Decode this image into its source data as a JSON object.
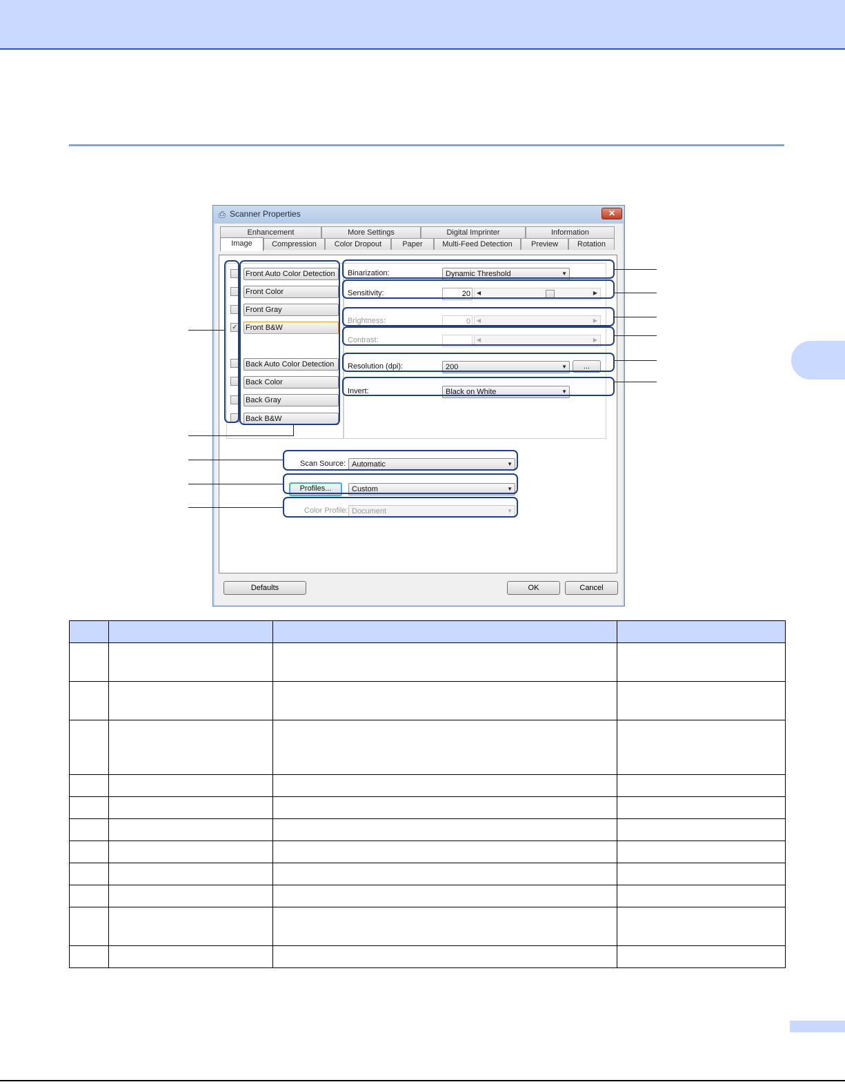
{
  "dialog": {
    "title": "Scanner Properties",
    "close_glyph": "✕",
    "tabs_back": [
      "Enhancement",
      "More Settings",
      "Digital Imprinter",
      "Information"
    ],
    "tabs_front": [
      "Image",
      "Compression",
      "Color Dropout",
      "Paper",
      "Multi-Feed Detection",
      "Preview",
      "Rotation"
    ],
    "active_tab": "Image"
  },
  "image_types": [
    {
      "label": "Front Auto Color Detection",
      "checked": false
    },
    {
      "label": "Front Color",
      "checked": false
    },
    {
      "label": "Front Gray",
      "checked": false
    },
    {
      "label": "Front B&W",
      "checked": true
    },
    {
      "label": "Back Auto Color Detection",
      "checked": false
    },
    {
      "label": "Back Color",
      "checked": false
    },
    {
      "label": "Back Gray",
      "checked": false
    },
    {
      "label": "Back B&W",
      "checked": false
    }
  ],
  "check_glyph": "✓",
  "settings": {
    "binarization": {
      "label": "Binarization:",
      "value": "Dynamic Threshold"
    },
    "sensitivity": {
      "label": "Sensitivity:",
      "value": "20",
      "level": 0.6
    },
    "brightness": {
      "label": "Brightness:",
      "value": "0",
      "enabled": false
    },
    "contrast": {
      "label": "Contrast:",
      "value": "",
      "enabled": false
    },
    "resolution": {
      "label": "Resolution (dpi):",
      "value": "200",
      "more_button": "..."
    },
    "invert": {
      "label": "Invert:",
      "value": "Black on White"
    }
  },
  "scan_source": {
    "label": "Scan Source:",
    "value": "Automatic"
  },
  "profiles": {
    "button": "Profiles...",
    "value": "Custom"
  },
  "color_profile": {
    "label": "Color Profile:",
    "value": "Document",
    "enabled": false
  },
  "buttons": {
    "defaults": "Defaults",
    "ok": "OK",
    "cancel": "Cancel"
  },
  "icons": {
    "dropdown": "arrow-down-icon",
    "left": "arrow-left-icon",
    "right": "arrow-right-icon",
    "app": "scanner-icon"
  },
  "colors": {
    "accent_band": "#cad9ff",
    "rule": "#7f9ff5",
    "callout_border": "#1f3f8c"
  },
  "table": {
    "columns": 4,
    "rows": 11
  }
}
